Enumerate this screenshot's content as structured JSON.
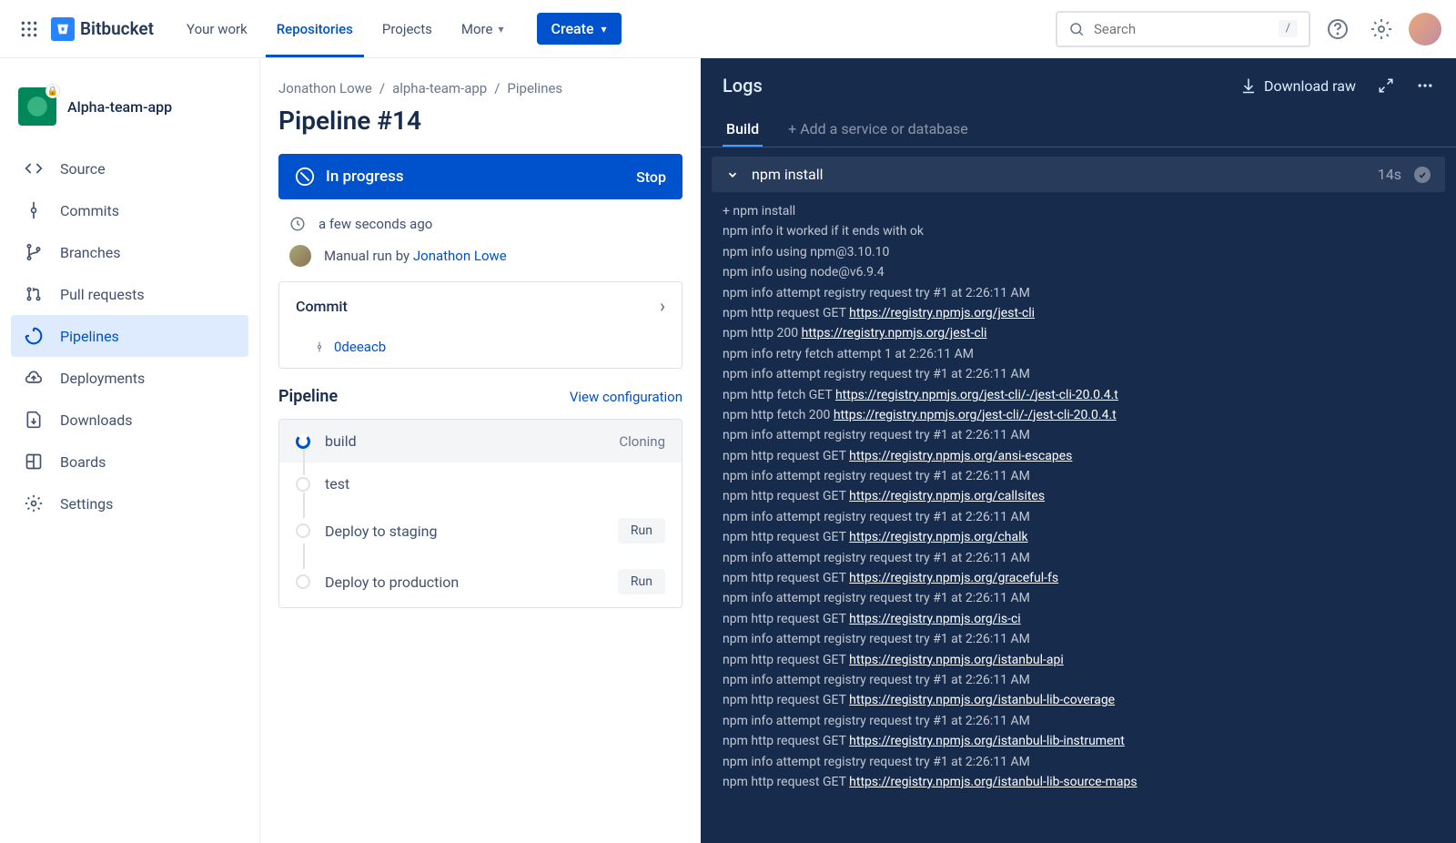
{
  "topnav": {
    "product": "Bitbucket",
    "items": {
      "your_work": "Your work",
      "repositories": "Repositories",
      "projects": "Projects",
      "more": "More"
    },
    "create": "Create",
    "search_placeholder": "Search",
    "shortcut": "/"
  },
  "sidebar": {
    "repo_name": "Alpha-team-app",
    "items": {
      "source": "Source",
      "commits": "Commits",
      "branches": "Branches",
      "pull_requests": "Pull requests",
      "pipelines": "Pipelines",
      "deployments": "Deployments",
      "downloads": "Downloads",
      "boards": "Boards",
      "settings": "Settings"
    }
  },
  "main": {
    "breadcrumb": {
      "user": "Jonathon Lowe",
      "repo": "alpha-team-app",
      "section": "Pipelines"
    },
    "title": "Pipeline #14",
    "status": {
      "label": "In progress",
      "action": "Stop"
    },
    "meta": {
      "time": "a few seconds ago",
      "trigger_pre": "Manual run by ",
      "trigger_user": "Jonathon Lowe"
    },
    "commit": {
      "label": "Commit",
      "hash": "0deeacb"
    },
    "pipeline": {
      "label": "Pipeline",
      "config_link": "View configuration",
      "steps": {
        "build": {
          "name": "build",
          "right": "Cloning"
        },
        "test": {
          "name": "test"
        },
        "staging": {
          "name": "Deploy to staging",
          "right": "Run"
        },
        "production": {
          "name": "Deploy to production",
          "right": "Run"
        }
      }
    }
  },
  "logs": {
    "title": "Logs",
    "download": "Download raw",
    "tabs": {
      "build": "Build",
      "add_service": "+ Add a service or database"
    },
    "step": {
      "name": "npm install",
      "time": "14s"
    },
    "lines": [
      {
        "t": "+ npm install"
      },
      {
        "t": "npm info it worked if it ends with ok"
      },
      {
        "t": "npm info using npm@3.10.10"
      },
      {
        "t": "npm info using node@v6.9.4"
      },
      {
        "t": "npm info attempt registry request try #1 at 2:26:11 AM"
      },
      {
        "t": "npm http request GET ",
        "u": "https://registry.npmjs.org/jest-cli"
      },
      {
        "t": "npm http 200 ",
        "u": "https://registry.npmjs.org/jest-cli"
      },
      {
        "t": "npm info retry fetch attempt 1 at 2:26:11 AM"
      },
      {
        "t": "npm info attempt registry request try #1 at 2:26:11 AM"
      },
      {
        "t": "npm http fetch GET ",
        "u": "https://registry.npmjs.org/jest-cli/-/jest-cli-20.0.4.t"
      },
      {
        "t": "npm http fetch 200 ",
        "u": "https://registry.npmjs.org/jest-cli/-/jest-cli-20.0.4.t"
      },
      {
        "t": "npm info attempt registry request try #1 at 2:26:11 AM"
      },
      {
        "t": "npm http request GET ",
        "u": "https://registry.npmjs.org/ansi-escapes"
      },
      {
        "t": "npm info attempt registry request try #1 at 2:26:11 AM"
      },
      {
        "t": "npm http request GET ",
        "u": "https://registry.npmjs.org/callsites"
      },
      {
        "t": "npm info attempt registry request try #1 at 2:26:11 AM"
      },
      {
        "t": "npm http request GET ",
        "u": "https://registry.npmjs.org/chalk"
      },
      {
        "t": "npm info attempt registry request try #1 at 2:26:11 AM"
      },
      {
        "t": "npm http request GET ",
        "u": "https://registry.npmjs.org/graceful-fs"
      },
      {
        "t": "npm info attempt registry request try #1 at 2:26:11 AM"
      },
      {
        "t": "npm http request GET ",
        "u": "https://registry.npmjs.org/is-ci"
      },
      {
        "t": "npm info attempt registry request try #1 at 2:26:11 AM"
      },
      {
        "t": "npm http request GET ",
        "u": "https://registry.npmjs.org/istanbul-api"
      },
      {
        "t": "npm info attempt registry request try #1 at 2:26:11 AM"
      },
      {
        "t": "npm http request GET ",
        "u": "https://registry.npmjs.org/istanbul-lib-coverage"
      },
      {
        "t": "npm info attempt registry request try #1 at 2:26:11 AM"
      },
      {
        "t": "npm http request GET ",
        "u": "https://registry.npmjs.org/istanbul-lib-instrument"
      },
      {
        "t": "npm info attempt registry request try #1 at 2:26:11 AM"
      },
      {
        "t": "npm http request GET ",
        "u": "https://registry.npmjs.org/istanbul-lib-source-maps"
      }
    ]
  }
}
